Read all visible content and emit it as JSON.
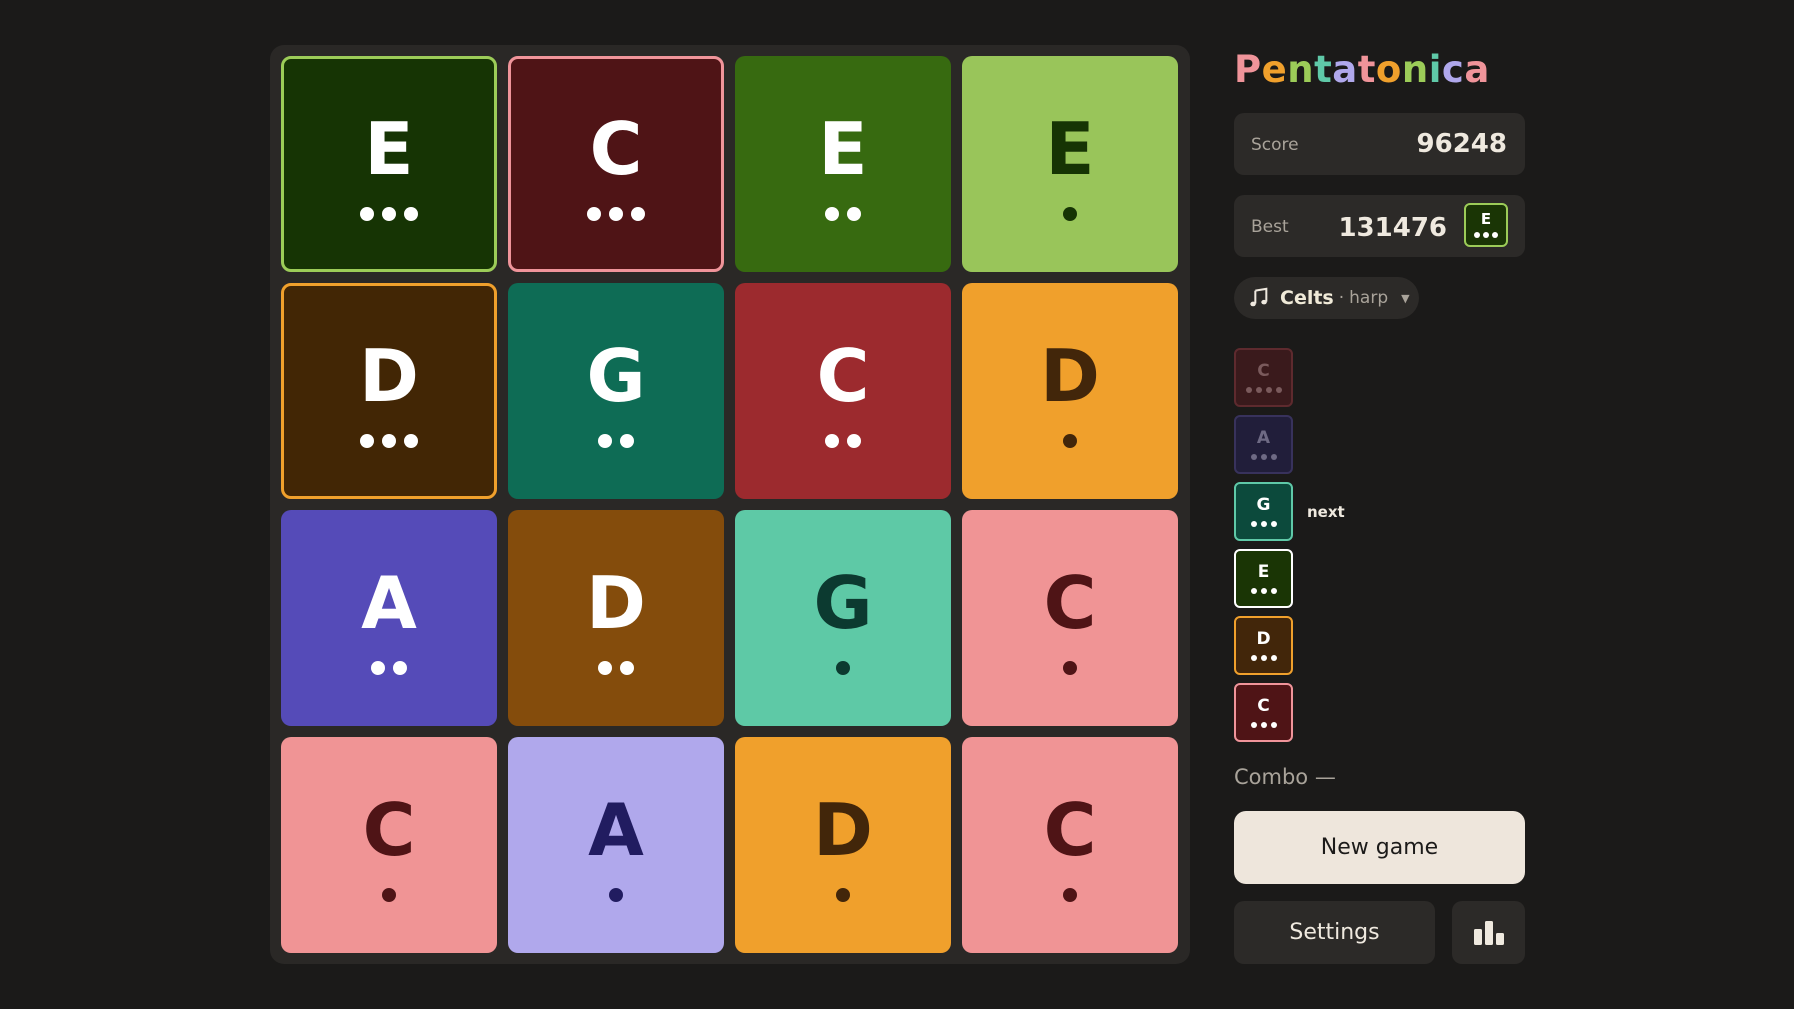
{
  "app": {
    "title": "Pentatonica",
    "title_colors": [
      "#f0949a",
      "#f0a02c",
      "#9ccc58",
      "#5fc9a8",
      "#b0a8ec",
      "#f0949a",
      "#f0a02c",
      "#9ccc58",
      "#5fc9a8",
      "#b0a8ec",
      "#f0949a"
    ]
  },
  "score": {
    "label": "Score",
    "value": "96248"
  },
  "best": {
    "label": "Best",
    "value": "131476",
    "chip_note": "E",
    "chip_level": 3
  },
  "instrument": {
    "name": "Celts",
    "separator": "·",
    "sub": "harp",
    "icon": "music-note-icon",
    "caret": "▼"
  },
  "queue": [
    {
      "note": "C",
      "level": 4,
      "bg": "#3a1a1c",
      "border": "#5e2a2e",
      "fg": "#7a5a5c"
    },
    {
      "note": "A",
      "level": 3,
      "bg": "#211e3a",
      "border": "#38325c",
      "fg": "#6e6a84"
    },
    {
      "note": "G",
      "level": 3,
      "bg": "#0c4a3c",
      "border": "#5fc9a8",
      "fg": "#ffffff"
    },
    {
      "note": "E",
      "level": 3,
      "bg": "#1a3505",
      "border": "#ffffff",
      "fg": "#ffffff"
    },
    {
      "note": "D",
      "level": 3,
      "bg": "#42260a",
      "border": "#f0a02c",
      "fg": "#ffffff"
    },
    {
      "note": "C",
      "level": 3,
      "bg": "#4f1416",
      "border": "#f0949a",
      "fg": "#ffffff"
    }
  ],
  "next_label": "next",
  "combo": "Combo —",
  "buttons": {
    "new_game": "New game",
    "settings": "Settings",
    "stats_icon": "bar-chart-icon"
  },
  "board": [
    {
      "note": "E",
      "level": 3,
      "bg": "#163404",
      "fg": "#ffffff",
      "border": "#9ccc58"
    },
    {
      "note": "C",
      "level": 3,
      "bg": "#4f1416",
      "fg": "#ffffff",
      "border": "#f0949a"
    },
    {
      "note": "E",
      "level": 2,
      "bg": "#376a10",
      "fg": "#ffffff"
    },
    {
      "note": "E",
      "level": 1,
      "bg": "#99c55a",
      "fg": "#163404"
    },
    {
      "note": "D",
      "level": 3,
      "bg": "#422605",
      "fg": "#ffffff",
      "border": "#f0a02c"
    },
    {
      "note": "G",
      "level": 2,
      "bg": "#0e6c55",
      "fg": "#ffffff"
    },
    {
      "note": "C",
      "level": 2,
      "bg": "#9c2a2e",
      "fg": "#ffffff"
    },
    {
      "note": "D",
      "level": 1,
      "bg": "#f0a02c",
      "fg": "#42260a"
    },
    {
      "note": "A",
      "level": 2,
      "bg": "#554bb8",
      "fg": "#ffffff"
    },
    {
      "note": "D",
      "level": 2,
      "bg": "#844c0c",
      "fg": "#ffffff"
    },
    {
      "note": "G",
      "level": 1,
      "bg": "#5ec9a6",
      "fg": "#0c3a30"
    },
    {
      "note": "C",
      "level": 1,
      "bg": "#f09495",
      "fg": "#4f1416"
    },
    {
      "note": "C",
      "level": 1,
      "bg": "#f09495",
      "fg": "#4f1416"
    },
    {
      "note": "A",
      "level": 1,
      "bg": "#b0a8ec",
      "fg": "#211c60"
    },
    {
      "note": "D",
      "level": 1,
      "bg": "#f0a02c",
      "fg": "#42260a"
    },
    {
      "note": "C",
      "level": 1,
      "bg": "#f09495",
      "fg": "#4f1416"
    }
  ]
}
